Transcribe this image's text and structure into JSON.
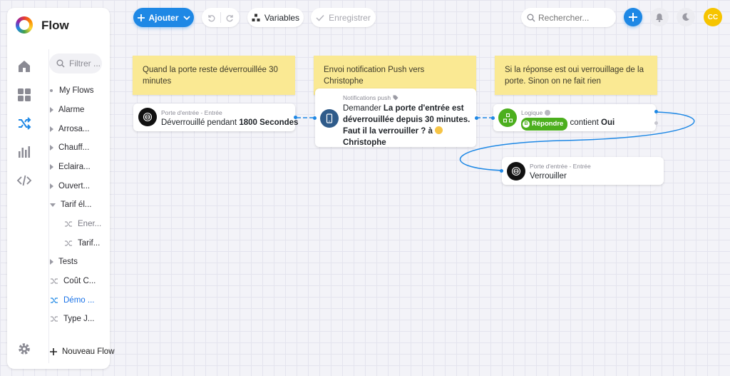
{
  "app": {
    "title": "Flow"
  },
  "filter": {
    "placeholder": "Filtrer ..."
  },
  "tree": {
    "root_label": "My Flows",
    "items": [
      {
        "label": "Alarme"
      },
      {
        "label": "Arrosa..."
      },
      {
        "label": "Chauff..."
      },
      {
        "label": "Eclaira..."
      },
      {
        "label": "Ouvert..."
      },
      {
        "label": "Tarif él..."
      },
      {
        "label": "Ener..."
      },
      {
        "label": "Tarif..."
      },
      {
        "label": "Tests"
      },
      {
        "label": "Coût C..."
      },
      {
        "label": "Démo ..."
      },
      {
        "label": "Type J..."
      }
    ],
    "new_flow": "Nouveau Flow"
  },
  "toolbar": {
    "add_label": "Ajouter",
    "variables_label": "Variables",
    "save_label": "Enregistrer",
    "search_placeholder": "Rechercher...",
    "avatar_initials": "CC"
  },
  "notes": [
    {
      "text": "Quand la porte reste déverrouillée 30 minutes"
    },
    {
      "text": "Envoi notification Push vers Christophe"
    },
    {
      "text": "Si la réponse est oui verrouillage de la porte. Sinon on ne fait rien"
    }
  ],
  "nodes": {
    "trigger": {
      "caption": "Porte d'entrée - Entrée",
      "prefix": "Déverrouillé pendant",
      "value": "1800",
      "unit": "Secondes"
    },
    "push": {
      "caption": "Notifications push",
      "verb": "Demander",
      "message": "La porte d'entrée est déverrouillée depuis 30 minutes. Faut il la verrouiller ? à",
      "recipient": "Christophe"
    },
    "logic": {
      "caption": "Logique",
      "badge": "Répondre",
      "badge_letter": "B",
      "condition": "contient",
      "value": "Oui"
    },
    "action": {
      "caption": "Porte d'entrée - Entrée",
      "text": "Verrouiller"
    }
  },
  "colors": {
    "accent": "#1e88e5",
    "note": "#fae993",
    "logic_green": "#4caf1e",
    "avatar": "#f6c400",
    "push_icon": "#2f5b8a"
  }
}
